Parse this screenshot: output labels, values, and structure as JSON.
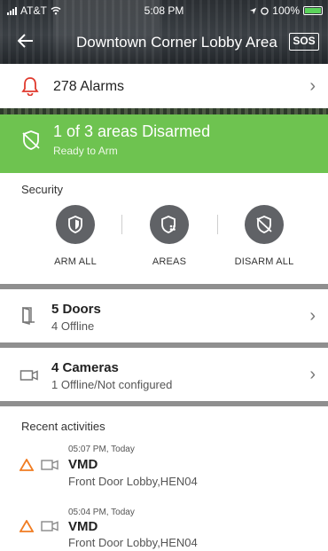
{
  "status_bar": {
    "carrier": "AT&T",
    "time": "5:08 PM",
    "battery": "100%"
  },
  "header": {
    "title": "Downtown Corner Lobby Area",
    "sos_label": "SOS"
  },
  "alarms": {
    "label": "278 Alarms"
  },
  "status_banner": {
    "title": "1 of 3 areas Disarmed",
    "subtitle": "Ready to Arm",
    "color": "#6ec350"
  },
  "security": {
    "label": "Security",
    "actions": [
      {
        "label": "ARM ALL",
        "icon": "shield-icon"
      },
      {
        "label": "AREAS",
        "icon": "areas-shield-icon"
      },
      {
        "label": "DISARM ALL",
        "icon": "shield-off-icon"
      }
    ]
  },
  "doors": {
    "title": "5 Doors",
    "subtitle": "4 Offline",
    "icon": "door-icon"
  },
  "cameras": {
    "title": "4 Cameras",
    "subtitle": "1 Offline/Not configured",
    "icon": "camera-icon"
  },
  "recent": {
    "label": "Recent activities",
    "items": [
      {
        "time": "05:07 PM, Today",
        "type": "VMD",
        "location": "Front Door Lobby,HEN04"
      },
      {
        "time": "05:04 PM, Today",
        "type": "VMD",
        "location": "Front Door Lobby,HEN04"
      }
    ]
  },
  "colors": {
    "alarm_red": "#e03a2e",
    "warning_orange": "#f07c22",
    "armed_green": "#6ec350",
    "icon_gray": "#606266"
  }
}
